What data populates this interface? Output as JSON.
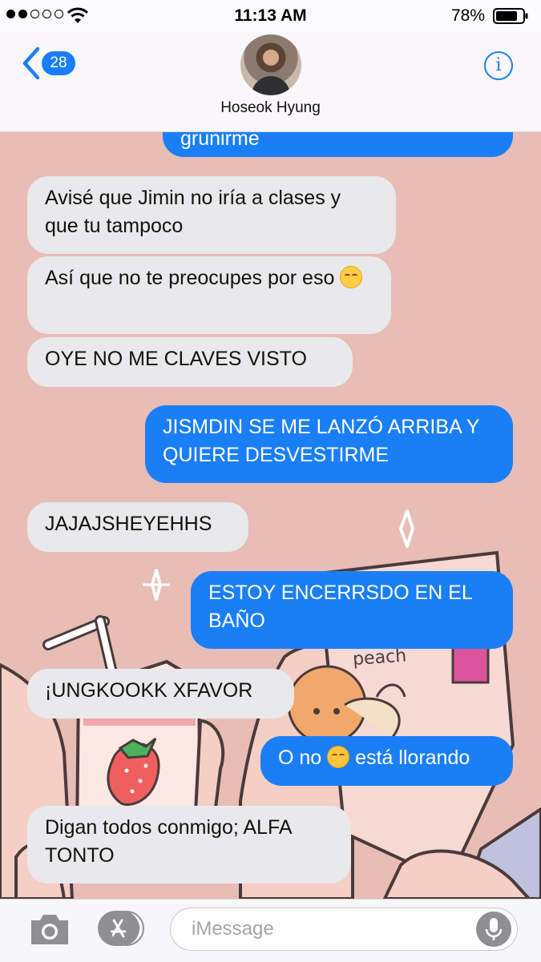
{
  "status_bar": {
    "time": "11:13 AM",
    "battery": "78%",
    "signal_bars_filled": 2,
    "signal_bars_total": 5
  },
  "header": {
    "back_badge": "28",
    "contact_name": "Hoseok Hyung",
    "info_icon": "info-icon",
    "back_icon": "chevron-left-icon"
  },
  "messages": [
    {
      "side": "out",
      "text": "grunirme"
    },
    {
      "side": "in",
      "text": "Avisé que Jimin no iría a clases y que tu tampoco"
    },
    {
      "side": "in",
      "text": "Así que no te preocupes por eso",
      "emoji": "relieved-face-emoji"
    },
    {
      "side": "in",
      "text": "OYE NO ME CLAVES VISTO"
    },
    {
      "side": "out",
      "text": "JISMDIN SE ME LANZÓ ARRIBA Y QUIERE DESVESTIRME"
    },
    {
      "side": "in",
      "text": "JAJAJSHEYEHHS"
    },
    {
      "side": "out",
      "text": "ESTOY ENCERRSDO EN EL BAÑO"
    },
    {
      "side": "in",
      "text": "¡UNGKOOKK XFAVOR"
    },
    {
      "side": "out",
      "text_before": "O no",
      "emoji": "confounded-face-emoji",
      "text_after": "está llorando"
    },
    {
      "side": "in",
      "text": "Digan todos conmigo; ALFA TONTO"
    }
  ],
  "wallpaper": {
    "carton_label": "peach",
    "colors": {
      "background": "#e8bdb5",
      "outgoing_bubble": "#1a7ff6",
      "incoming_bubble": "#e9e9eb"
    }
  },
  "input_bar": {
    "placeholder": "iMessage",
    "camera_icon": "camera-icon",
    "apps_icon": "app-store-icon",
    "mic_icon": "microphone-icon"
  }
}
